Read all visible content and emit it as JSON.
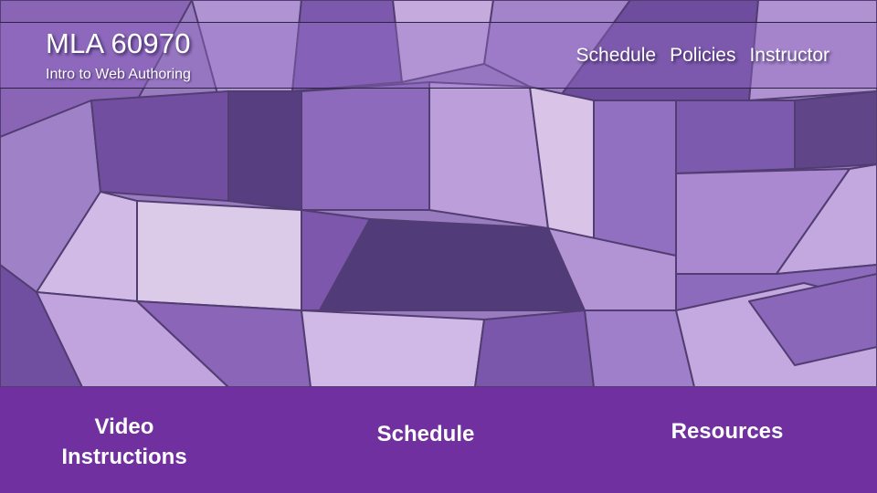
{
  "header": {
    "course_code": "MLA 60970",
    "course_title": "Intro to Web Authoring"
  },
  "nav": {
    "items": [
      "Schedule",
      "Policies",
      "Instructor"
    ]
  },
  "actions": {
    "video_line1": "Video",
    "video_line2": "Instructions",
    "schedule": "Schedule",
    "resources": "Resources"
  },
  "colors": {
    "action_bar": "#7030a0",
    "header_text": "#ffffff"
  }
}
